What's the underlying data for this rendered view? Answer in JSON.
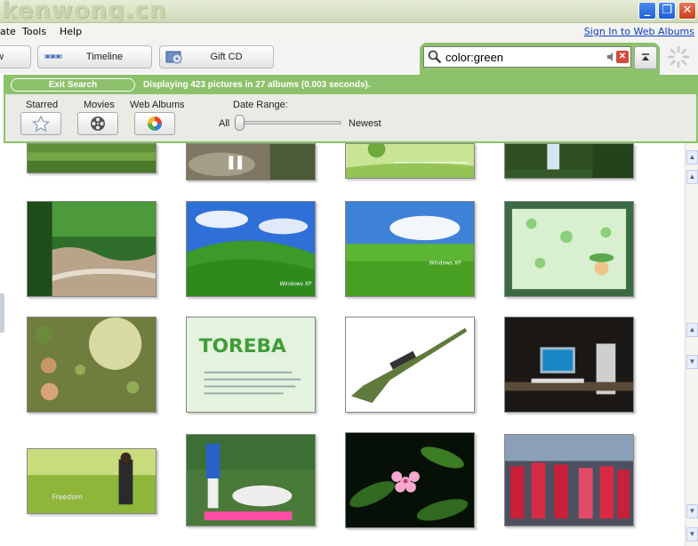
{
  "window": {
    "watermark": "kenwong.cn",
    "min_glyph": "_",
    "max_glyph": "❐",
    "close_glyph": "✕"
  },
  "menu": {
    "items": [
      "ate",
      "Tools",
      "Help"
    ],
    "signin": "Sign In to Web Albums"
  },
  "toolbar": {
    "buttons": [
      "w",
      "Timeline",
      "Gift CD"
    ]
  },
  "search": {
    "value": "color:green",
    "clear_glyph": "✕"
  },
  "results": {
    "exit_label": "Exit Search",
    "status": "Displaying 423 pictures in 27 albums (0.003 seconds).",
    "filters": {
      "starred": "Starred",
      "movies": "Movies",
      "web_albums": "Web Albums"
    },
    "date_range": {
      "label": "Date Range:",
      "min_label": "All",
      "max_label": "Newest",
      "value": 0
    }
  },
  "gallery": {
    "thumbnails": [
      {
        "name": "green-grass"
      },
      {
        "name": "tree-roots-shoes"
      },
      {
        "name": "light-green-abstract"
      },
      {
        "name": "waterfall-forest"
      },
      {
        "name": "forest-river"
      },
      {
        "name": "windows-xp-bliss",
        "caption": "Windows XP"
      },
      {
        "name": "windows-xp-green-field",
        "caption": "Windows XP"
      },
      {
        "name": "cartoon-frog-frame"
      },
      {
        "name": "cartoon-children-garden"
      },
      {
        "name": "toreba-poster",
        "caption": "TOREBA"
      },
      {
        "name": "sniper-rifle"
      },
      {
        "name": "computer-desk-night"
      },
      {
        "name": "girl-in-meadow",
        "caption": "Freedom"
      },
      {
        "name": "soccer-players"
      },
      {
        "name": "pink-flower"
      },
      {
        "name": "dancers-red-costumes"
      }
    ]
  },
  "colors": {
    "accent": "#8dc16b",
    "link": "#0b3cc9"
  }
}
